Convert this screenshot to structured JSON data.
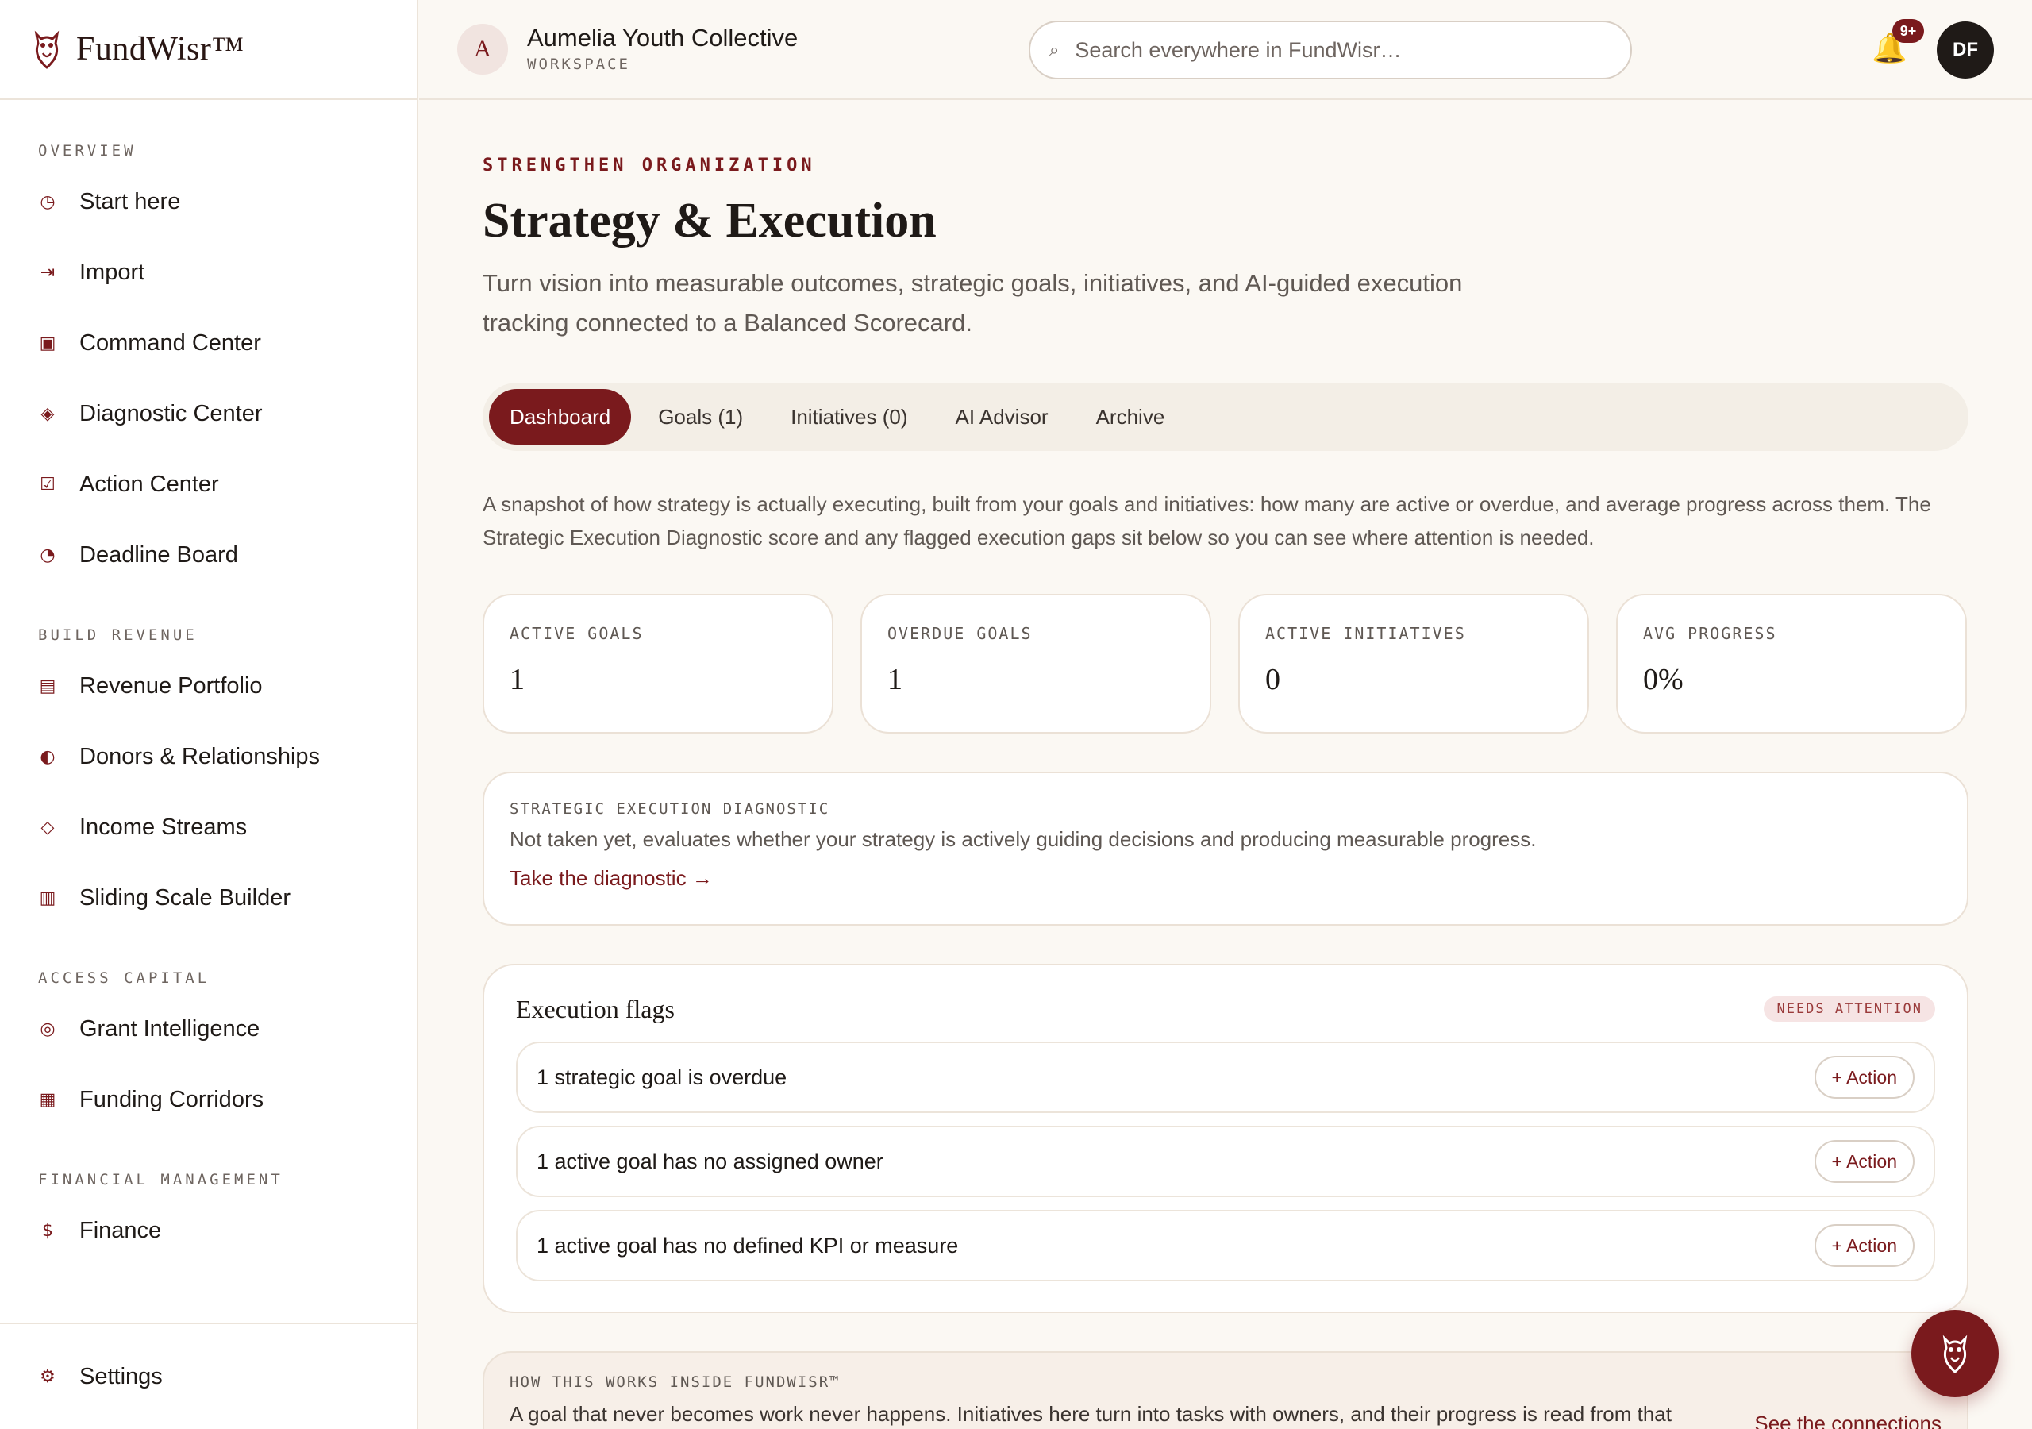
{
  "brand": {
    "name": "FundWisr™"
  },
  "workspace": {
    "initial": "A",
    "name": "Aumelia Youth Collective",
    "sub": "WORKSPACE"
  },
  "search": {
    "placeholder": "Search everywhere in FundWisr…"
  },
  "notifications": {
    "badge": "9+"
  },
  "user": {
    "initials": "DF"
  },
  "sidebar": {
    "sections": [
      {
        "title": "OVERVIEW",
        "items": [
          {
            "label": "Start here",
            "icon": "◷"
          },
          {
            "label": "Import",
            "icon": "⇥"
          },
          {
            "label": "Command Center",
            "icon": "▣"
          },
          {
            "label": "Diagnostic Center",
            "icon": "◈"
          },
          {
            "label": "Action Center",
            "icon": "☑"
          },
          {
            "label": "Deadline Board",
            "icon": "◔"
          }
        ]
      },
      {
        "title": "BUILD REVENUE",
        "items": [
          {
            "label": "Revenue Portfolio",
            "icon": "▤"
          },
          {
            "label": "Donors & Relationships",
            "icon": "◐"
          },
          {
            "label": "Income Streams",
            "icon": "◇"
          },
          {
            "label": "Sliding Scale Builder",
            "icon": "▥"
          }
        ]
      },
      {
        "title": "ACCESS CAPITAL",
        "items": [
          {
            "label": "Grant Intelligence",
            "icon": "◎"
          },
          {
            "label": "Funding Corridors",
            "icon": "▦"
          }
        ]
      },
      {
        "title": "FINANCIAL MANAGEMENT",
        "items": [
          {
            "label": "Finance",
            "icon": "$"
          }
        ]
      }
    ],
    "settings": {
      "label": "Settings",
      "icon": "⚙"
    }
  },
  "page": {
    "eyebrow": "STRENGTHEN ORGANIZATION",
    "title": "Strategy & Execution",
    "description": "Turn vision into measurable outcomes, strategic goals, initiatives, and AI-guided execution tracking connected to a Balanced Scorecard."
  },
  "tabs": [
    "Dashboard",
    "Goals (1)",
    "Initiatives (0)",
    "AI Advisor",
    "Archive"
  ],
  "intro": "A snapshot of how strategy is actually executing, built from your goals and initiatives: how many are active or overdue, and average progress across them. The Strategic Execution Diagnostic score and any flagged execution gaps sit below so you can see where attention is needed.",
  "stats": [
    {
      "label": "ACTIVE GOALS",
      "value": "1"
    },
    {
      "label": "OVERDUE GOALS",
      "value": "1"
    },
    {
      "label": "ACTIVE INITIATIVES",
      "value": "0"
    },
    {
      "label": "AVG PROGRESS",
      "value": "0%"
    }
  ],
  "diagnostic": {
    "eyebrow": "STRATEGIC EXECUTION DIAGNOSTIC",
    "text": "Not taken yet, evaluates whether your strategy is actively guiding decisions and producing measurable progress.",
    "link": "Take the diagnostic →"
  },
  "flags": {
    "title": "Execution flags",
    "badge": "NEEDS ATTENTION",
    "items": [
      {
        "text": "1 strategic goal is overdue",
        "action": "+ Action"
      },
      {
        "text": "1 active goal has no assigned owner",
        "action": "+ Action"
      },
      {
        "text": "1 active goal has no defined KPI or measure",
        "action": "+ Action"
      }
    ]
  },
  "how": {
    "eyebrow": "HOW THIS WORKS INSIDE FUNDWISR™",
    "text": "A goal that never becomes work never happens. Initiatives here turn into tasks with owners, and their progress is read from that",
    "link": "See the connections"
  },
  "colors": {
    "accent": "#7a1a1d",
    "background": "#fbf8f3",
    "bell": "#e8a83a"
  }
}
